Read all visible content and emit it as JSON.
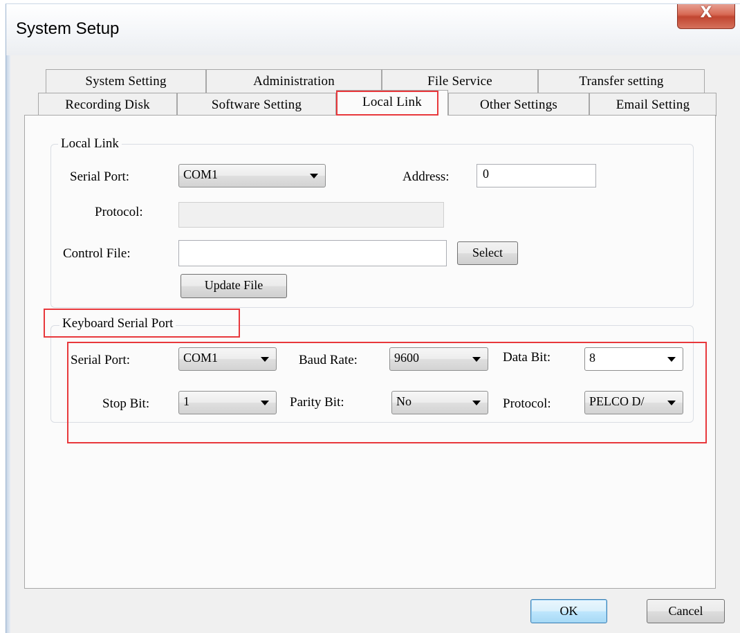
{
  "window": {
    "title": "System Setup",
    "close_glyph": "X"
  },
  "tabs": {
    "row1": [
      "System Setting",
      "Administration",
      "File Service",
      "Transfer setting"
    ],
    "row2": [
      "Recording Disk",
      "Software Setting",
      "Local Link",
      "Other Settings",
      "Email Setting"
    ],
    "active": "Local Link"
  },
  "local_link": {
    "group_label": "Local Link",
    "serial_port_label": "Serial Port:",
    "serial_port_value": "COM1",
    "address_label": "Address:",
    "address_value": "0",
    "protocol_label": "Protocol:",
    "protocol_value": "",
    "control_file_label": "Control File:",
    "control_file_value": "",
    "select_button": "Select",
    "update_file_button": "Update File"
  },
  "keyboard_serial_port": {
    "group_label": "Keyboard Serial Port",
    "serial_port_label": "Serial Port:",
    "serial_port_value": "COM1",
    "baud_rate_label": "Baud Rate:",
    "baud_rate_value": "9600",
    "data_bit_label": "Data Bit:",
    "data_bit_value": "8",
    "stop_bit_label": "Stop Bit:",
    "stop_bit_value": "1",
    "parity_bit_label": "Parity Bit:",
    "parity_bit_value": "No",
    "protocol_label": "Protocol:",
    "protocol_value": "PELCO D/"
  },
  "footer": {
    "ok_button": "OK",
    "cancel_button": "Cancel"
  },
  "colors": {
    "highlight": "#e8373b",
    "close_button": "#c14631",
    "default_button": "#3c7fb1"
  },
  "icons": {
    "close": "close-icon",
    "dropdown": "chevron-down-icon"
  }
}
